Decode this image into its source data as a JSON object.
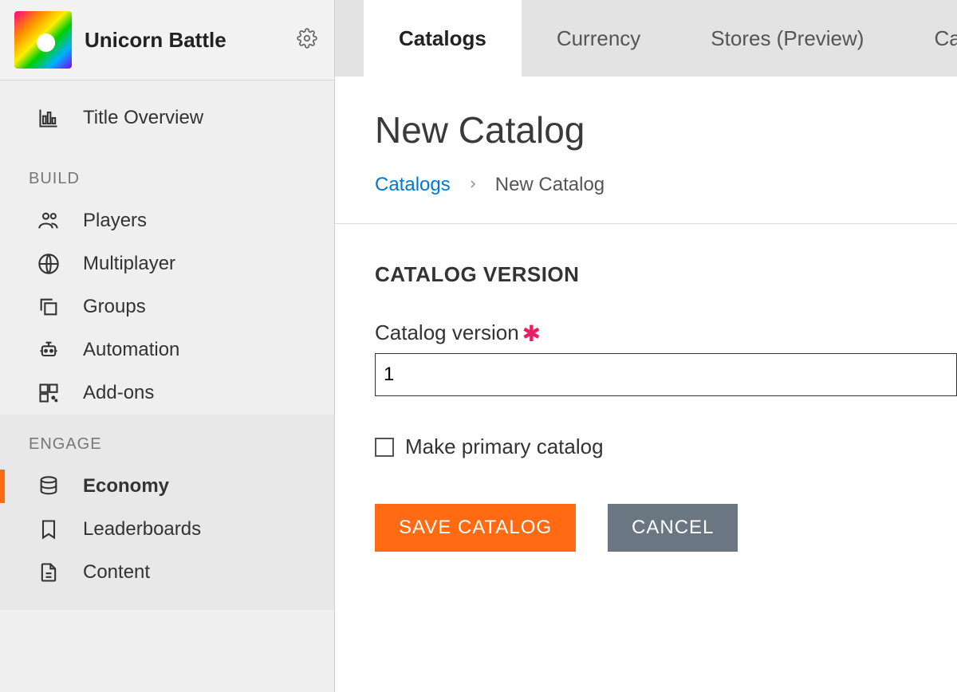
{
  "app": {
    "title": "Unicorn Battle"
  },
  "sidebar": {
    "overview_label": "Title Overview",
    "sections": {
      "build": {
        "label": "BUILD",
        "items": [
          {
            "label": "Players"
          },
          {
            "label": "Multiplayer"
          },
          {
            "label": "Groups"
          },
          {
            "label": "Automation"
          },
          {
            "label": "Add-ons"
          }
        ]
      },
      "engage": {
        "label": "ENGAGE",
        "items": [
          {
            "label": "Economy",
            "active": true
          },
          {
            "label": "Leaderboards"
          },
          {
            "label": "Content"
          }
        ]
      }
    }
  },
  "tabs": [
    {
      "label": "Catalogs",
      "active": true
    },
    {
      "label": "Currency"
    },
    {
      "label": "Stores (Preview)"
    },
    {
      "label": "Cata"
    }
  ],
  "page": {
    "title": "New Catalog",
    "breadcrumb": {
      "parent": "Catalogs",
      "current": "New Catalog"
    },
    "section_heading": "CATALOG VERSION",
    "form": {
      "version_label": "Catalog version",
      "version_value": "1",
      "primary_label": "Make primary catalog",
      "primary_checked": false
    },
    "buttons": {
      "save": "SAVE CATALOG",
      "cancel": "CANCEL"
    }
  }
}
